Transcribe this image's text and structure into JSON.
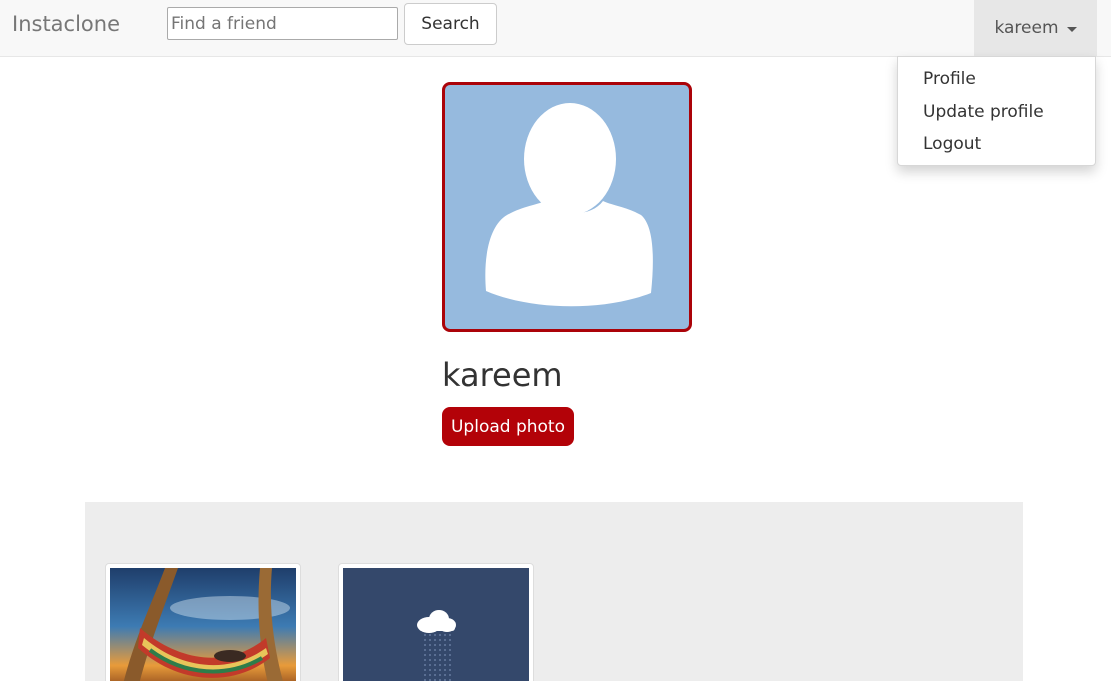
{
  "navbar": {
    "brand": "Instaclone",
    "search_placeholder": "Find a friend",
    "search_value": "",
    "search_button": "Search",
    "user_menu_label": "kareem"
  },
  "dropdown": {
    "items": [
      {
        "label": "Profile"
      },
      {
        "label": "Update profile"
      },
      {
        "label": "Logout"
      }
    ]
  },
  "profile": {
    "username": "kareem",
    "upload_button": "Upload photo",
    "avatar_icon": "default-user-silhouette"
  },
  "gallery": {
    "photos": [
      {
        "subject": "hammock-sunset-photo"
      },
      {
        "subject": "rain-cloud-illustration"
      }
    ]
  },
  "colors": {
    "accent": "#b30208",
    "avatar_border": "#ab0309",
    "avatar_bg": "#96bade",
    "navbar_bg": "#f8f8f8",
    "gallery_bg": "#ededed"
  }
}
